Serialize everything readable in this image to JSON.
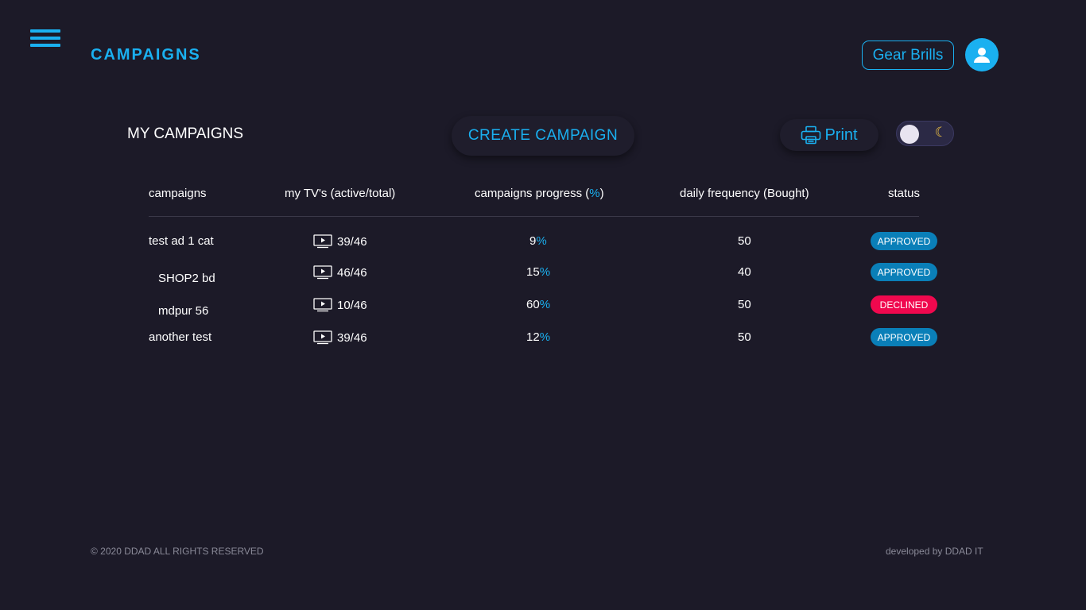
{
  "header": {
    "title": "CAMPAIGNS",
    "user_name": "Gear Brills",
    "accent": "#1ab0f0"
  },
  "toolbar": {
    "section_title": "MY CAMPAIGNS",
    "create_label": "CREATE CAMPAIGN",
    "print_label": "Print",
    "theme_toggle_icon": "moon-icon"
  },
  "table": {
    "headers": {
      "campaigns": "campaigns",
      "tvs": "my TV's (active/total)",
      "progress_prefix": "campaigns progress (",
      "progress_unit": "%",
      "progress_suffix": ")",
      "frequency": "daily frequency (Bought)",
      "status": "status"
    },
    "rows": [
      {
        "name": "test ad 1 cat",
        "tvs": "39/46",
        "progress": "9",
        "unit": "%",
        "frequency": "50",
        "status": "APPROVED",
        "status_color": "#0a7fb8"
      },
      {
        "name": "SHOP2 bd",
        "tvs": "46/46",
        "progress": "15",
        "unit": "%",
        "frequency": "40",
        "status": "APPROVED",
        "status_color": "#0a7fb8"
      },
      {
        "name": "mdpur 56",
        "tvs": "10/46",
        "progress": "60",
        "unit": "%",
        "frequency": "50",
        "status": "DECLINED",
        "status_color": "#f0084e"
      },
      {
        "name": "another test",
        "tvs": "39/46",
        "progress": "12",
        "unit": "%",
        "frequency": "50",
        "status": "APPROVED",
        "status_color": "#0a7fb8"
      }
    ]
  },
  "footer": {
    "copyright": "© 2020 DDAD ALL RIGHTS RESERVED",
    "developer": "developed by DDAD IT"
  }
}
